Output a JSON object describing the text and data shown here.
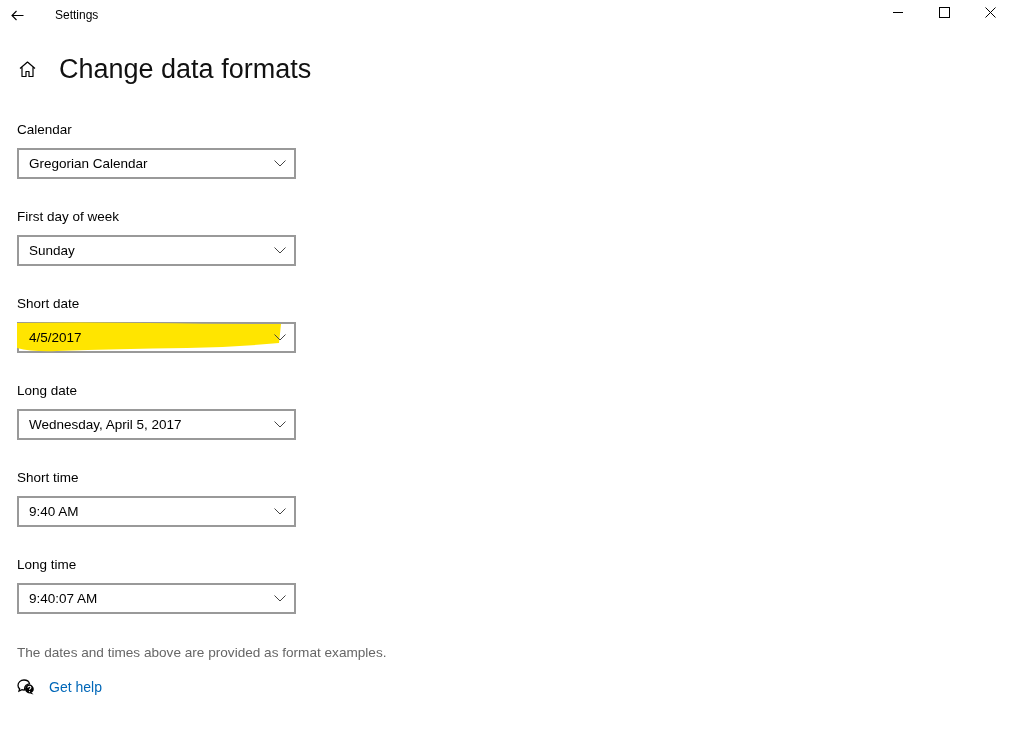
{
  "window": {
    "title": "Settings"
  },
  "page": {
    "title": "Change data formats"
  },
  "settings": [
    {
      "label": "Calendar",
      "value": "Gregorian Calendar",
      "highlighted": false
    },
    {
      "label": "First day of week",
      "value": "Sunday",
      "highlighted": false
    },
    {
      "label": "Short date",
      "value": "4/5/2017",
      "highlighted": true
    },
    {
      "label": "Long date",
      "value": "Wednesday, April 5, 2017",
      "highlighted": false
    },
    {
      "label": "Short time",
      "value": "9:40 AM",
      "highlighted": false
    },
    {
      "label": "Long time",
      "value": "9:40:07 AM",
      "highlighted": false
    }
  ],
  "note": "The dates and times above are provided as format examples.",
  "help_link": "Get help"
}
